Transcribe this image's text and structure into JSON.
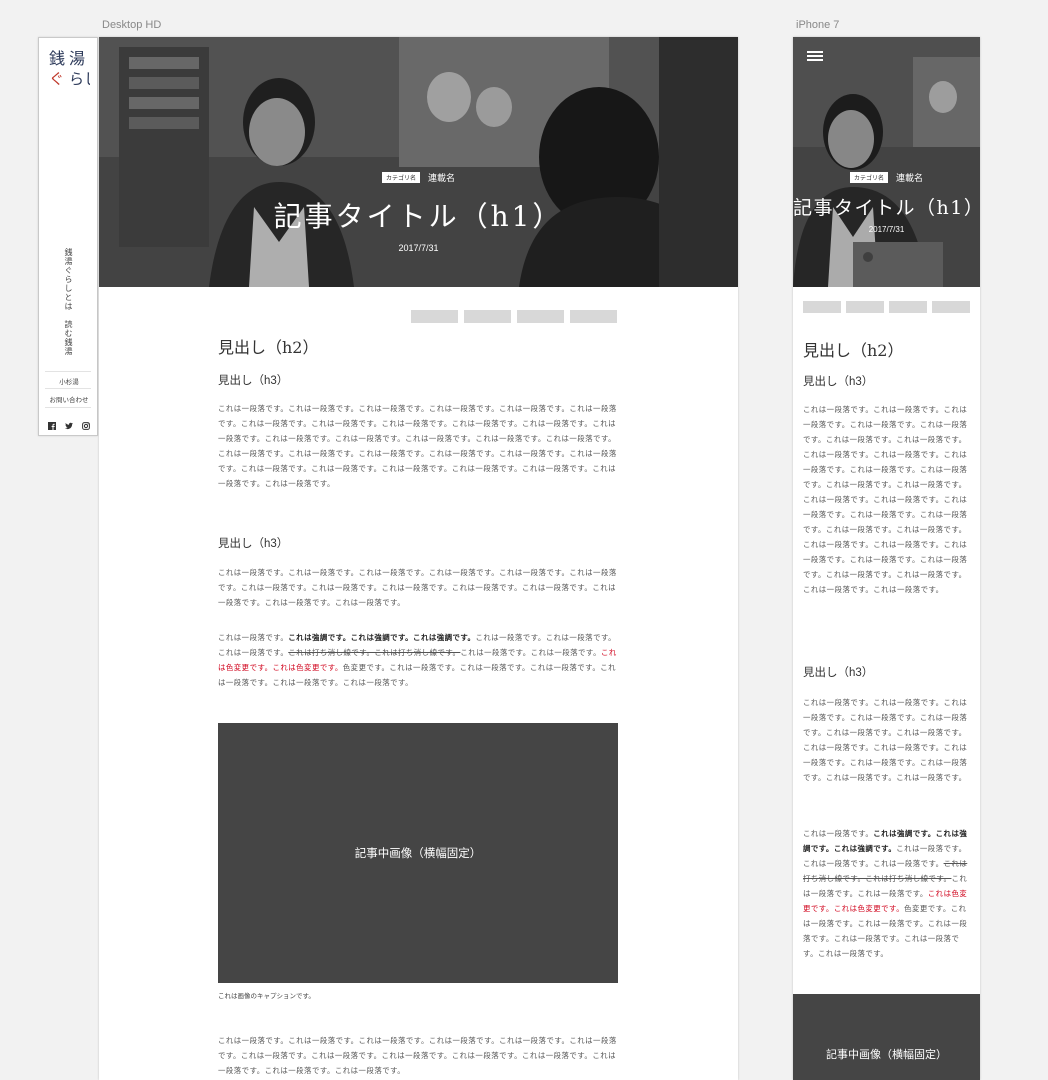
{
  "frames": {
    "desktop": "Desktop HD",
    "mobile": "iPhone 7"
  },
  "nav": {
    "logo_text": "銭湯ぐらし",
    "about": "銭湯ぐらしとは",
    "read": "読む銭湯",
    "link1": "小杉湯",
    "link2": "お問い合わせ",
    "social": [
      "facebook-icon",
      "twitter-icon",
      "instagram-icon"
    ]
  },
  "hero": {
    "category": "カテゴリ名",
    "series": "連載名",
    "title": "記事タイトル（h1）",
    "date": "2017/7/31"
  },
  "article": {
    "h2": "見出し（h2）",
    "h3_a": "見出し（h3）",
    "p1": "これは一段落です。これは一段落です。これは一段落です。これは一段落です。これは一段落です。これは一段落です。これは一段落です。これは一段落です。これは一段落です。これは一段落です。これは一段落です。これは一段落です。これは一段落です。これは一段落です。これは一段落です。これは一段落です。これは一段落です。これは一段落です。これは一段落です。これは一段落です。これは一段落です。これは一段落です。これは一段落です。これは一段落です。これは一段落です。これは一段落です。これは一段落です。これは一段落です。これは一段落です。これは一段落です。",
    "h3_b": "見出し（h3）",
    "p2": "これは一段落です。これは一段落です。これは一段落です。これは一段落です。これは一段落です。これは一段落です。これは一段落です。これは一段落です。これは一段落です。これは一段落です。これは一段落です。これは一段落です。これは一段落です。これは一段落です。",
    "p3": {
      "lead": "これは一段落です。",
      "bold": "これは強調です。これは強調です。これは強調です。",
      "mid": "これは一段落です。これは一段落です。これは一段落です。",
      "strike": "これは打ち消し線です。これは打ち消し線です。",
      "mid2": "これは一段落です。これは一段落です。",
      "red": "これは色変更です。これは色変更です。",
      "after": "色変更です。これは一段落です。これは一段落です。これは一段落です。これは一段落です。これは一段落です。これは一段落です。"
    },
    "image_label": "記事中画像（横幅固定）",
    "caption": "これは画像のキャプションです。",
    "p4": "これは一段落です。これは一段落です。これは一段落です。これは一段落です。これは一段落です。これは一段落です。これは一段落です。これは一段落です。これは一段落です。これは一段落です。これは一段落です。これは一段落です。これは一段落です。これは一段落です。"
  },
  "mobile": {
    "p1": "これは一段落です。これは一段落です。これは一段落です。これは一段落です。これは一段落です。これは一段落です。これは一段落です。これは一段落です。これは一段落です。これは一段落です。これは一段落です。これは一段落です。これは一段落です。これは一段落です。これは一段落です。これは一段落です。これは一段落です。これは一段落です。これは一段落です。これは一段落です。これは一段落です。これは一段落です。これは一段落です。これは一段落です。これは一段落です。これは一段落です。これは一段落です。これは一段落です。これは一段落です。これは一段落です。",
    "p2": "これは一段落です。これは一段落です。これは一段落です。これは一段落です。これは一段落です。これは一段落です。これは一段落です。これは一段落です。これは一段落です。これは一段落です。これは一段落です。これは一段落です。これは一段落です。これは一段落です。"
  },
  "colors": {
    "accent_red": "#d0021b",
    "image_placeholder": "#454545",
    "tag_placeholder": "#d8d8d8"
  }
}
